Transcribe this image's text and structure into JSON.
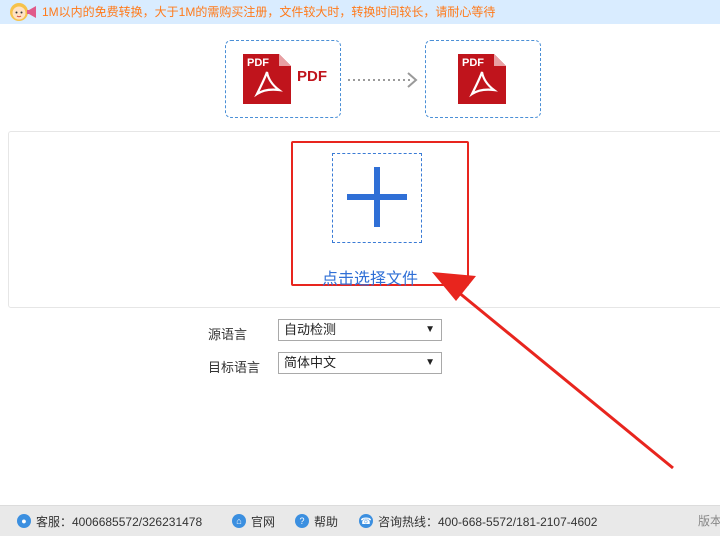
{
  "notice": {
    "text": "1M以内的免费转换，大于1M的需购买注册，文件较大时，转换时间较长，请耐心等待",
    "mascot_icon": "girl-megaphone-icon",
    "text_color": "#ff7a1a"
  },
  "conversion": {
    "source_doc_label": "PDF",
    "source_format_tag": "PDF",
    "target_doc_label": "PDF"
  },
  "upload": {
    "choose_file_label": "点击选择文件"
  },
  "language": {
    "source_label": "源语言",
    "source_value": "自动检测",
    "target_label": "目标语言",
    "target_value": "简体中文"
  },
  "footer": {
    "service_label": "客服：4006685572/326231478",
    "website_label": "官网",
    "help_label": "帮助",
    "hotline_label": "咨询热线：400-668-5572/181-2107-4602",
    "version_label": "版本"
  },
  "colors": {
    "accent_blue": "#2f6fd6",
    "annotation_red": "#e8251e",
    "pdf_red": "#c0141c"
  }
}
